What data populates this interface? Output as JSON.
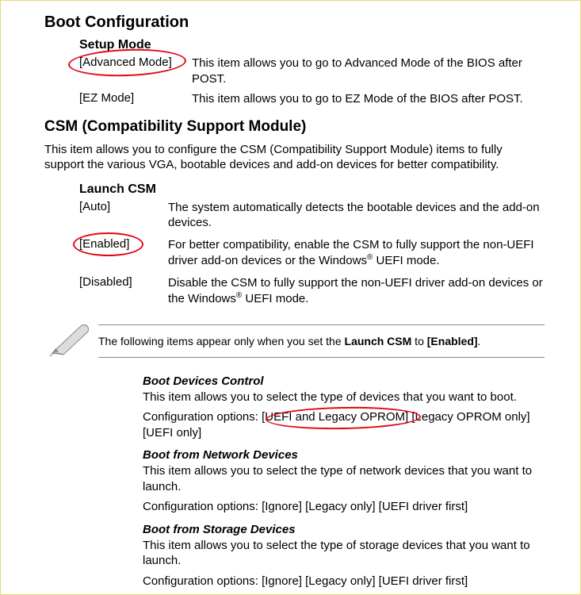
{
  "boot": {
    "title": "Boot Configuration",
    "setupMode": {
      "title": "Setup Mode",
      "options": [
        {
          "label": "[Advanced Mode]",
          "desc": "This item allows you to go to Advanced Mode of the BIOS after POST."
        },
        {
          "label": "[EZ Mode]",
          "desc": "This item allows you to go to EZ Mode of the BIOS after POST."
        }
      ]
    }
  },
  "csm": {
    "title": "CSM (Compatibility Support Module)",
    "desc": "This item allows you to configure the CSM (Compatibility Support Module) items to fully support the various VGA, bootable devices and add-on devices for better compatibility.",
    "launch": {
      "title": "Launch CSM",
      "options": [
        {
          "label": "[Auto]",
          "desc": "The system automatically detects the bootable devices and the add-on devices."
        },
        {
          "label": "[Enabled]",
          "desc_pre": "For better compatibility, enable the CSM to fully support the non-UEFI driver add-on devices or the Windows",
          "desc_post": " UEFI mode."
        },
        {
          "label": "[Disabled]",
          "desc_pre": "Disable the CSM to fully support the non-UEFI driver add-on devices or the Windows",
          "desc_post": " UEFI mode."
        }
      ]
    }
  },
  "note": {
    "text_pre": "The following items appear only when you set the ",
    "text_bold1": "Launch CSM",
    "text_mid": " to ",
    "text_bold2": "[Enabled]",
    "text_post": "."
  },
  "sub": {
    "bootDevices": {
      "title": "Boot Devices Control",
      "desc": "This item allows you to select the type of devices that you want to boot.",
      "config_pre": "Configuration options: ",
      "config_opt1": "[UEFI and Legacy OPROM]",
      "config_rest": " [Legacy OPROM only] [UEFI only]"
    },
    "network": {
      "title": "Boot from Network Devices",
      "desc": "This item allows you to select the type of network devices that you want to launch.",
      "config": "Configuration options: [Ignore] [Legacy only] [UEFI driver first]"
    },
    "storage": {
      "title": "Boot from Storage Devices",
      "desc": "This item allows you to select the type of storage devices that you want to launch.",
      "config": "Configuration options: [Ignore] [Legacy only] [UEFI driver first]"
    }
  }
}
